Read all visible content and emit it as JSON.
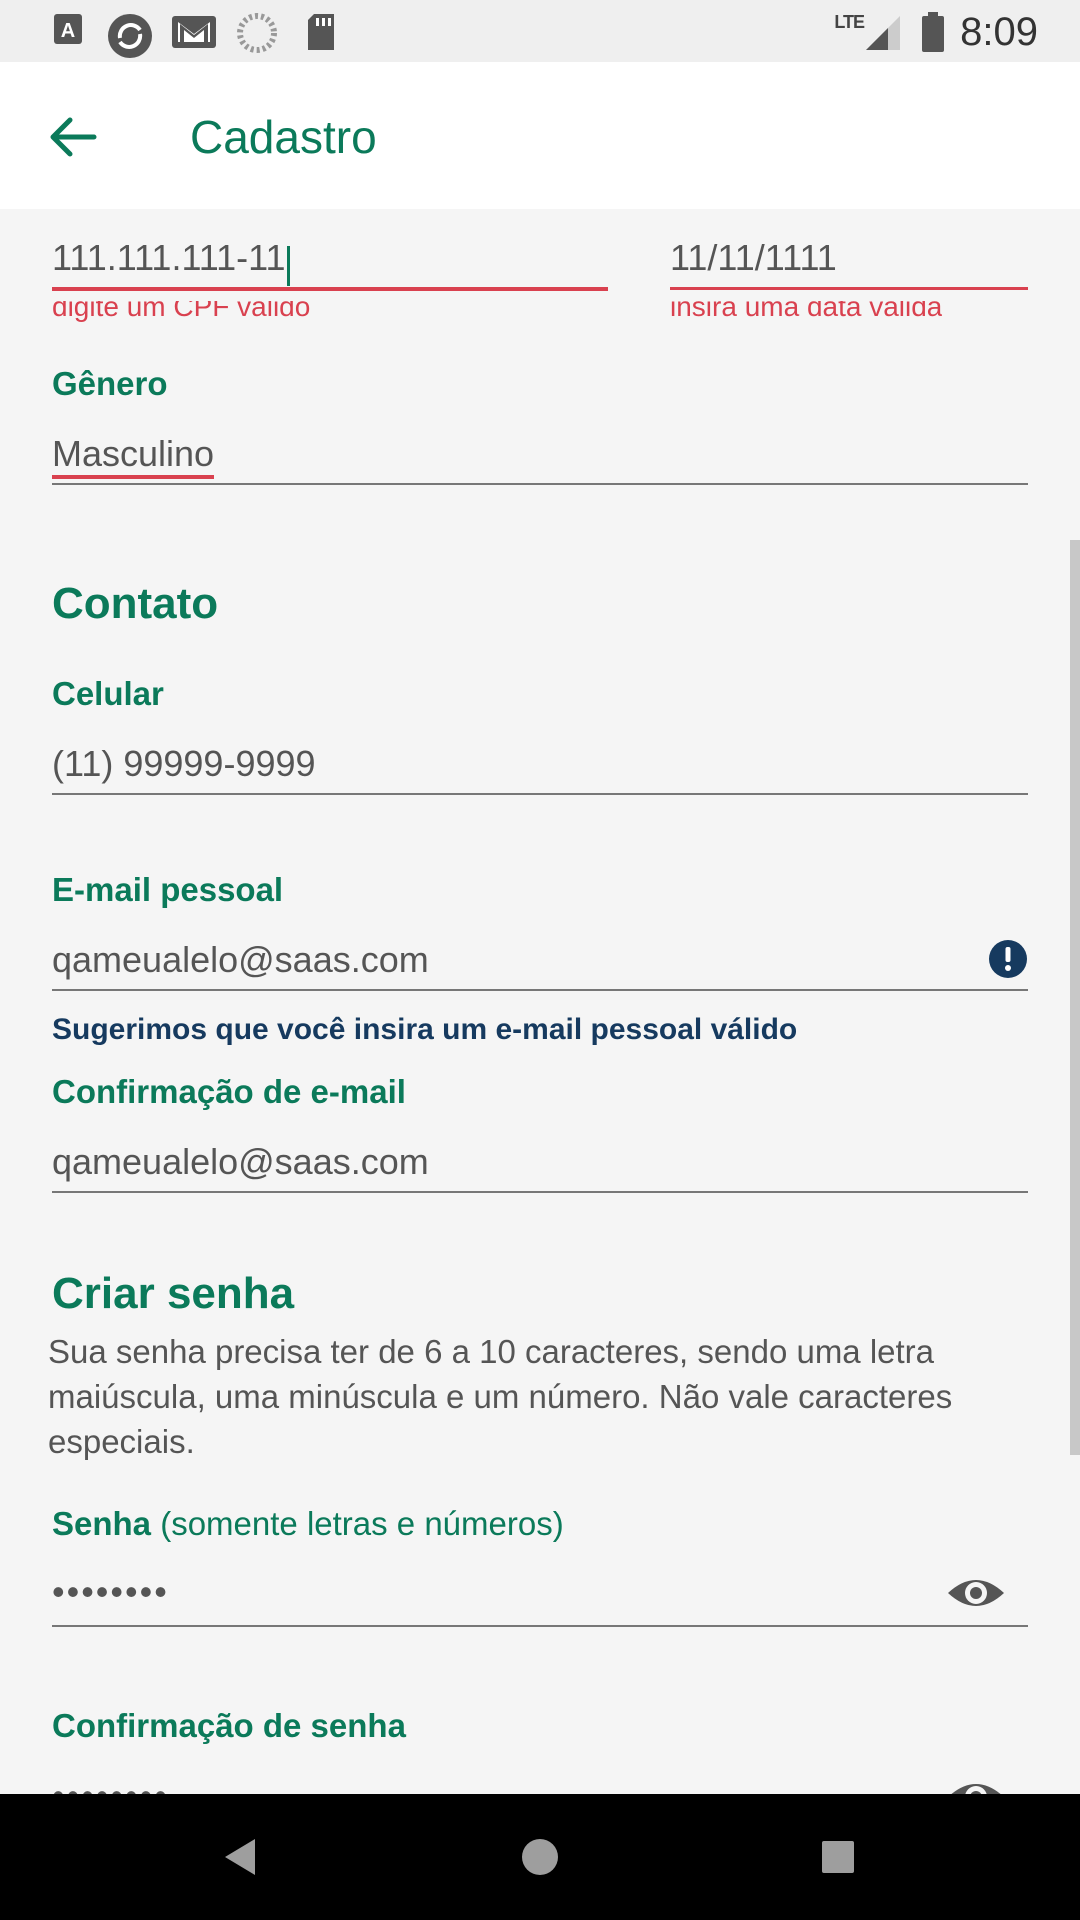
{
  "status_bar": {
    "time": "8:09",
    "network": "LTE",
    "icons": [
      "text-a-icon",
      "sync-icon",
      "gmail-icon",
      "loading-icon",
      "sd-card-icon",
      "signal-icon",
      "battery-icon"
    ]
  },
  "app_bar": {
    "title": "Cadastro",
    "back_icon": "arrow-left-icon"
  },
  "form": {
    "cpf": {
      "value": "111.111.111-11",
      "error": "digite um CPF válido"
    },
    "birthdate": {
      "value": "11/11/1111",
      "error": "insira uma data válida"
    },
    "gender": {
      "label": "Gênero",
      "value": "Masculino"
    },
    "contact": {
      "title": "Contato",
      "phone": {
        "label": "Celular",
        "placeholder": "(11) 99999-9999"
      },
      "email": {
        "label": "E-mail pessoal",
        "value": "qameualelo@saas.com",
        "hint": "Sugerimos que você insira um e-mail pessoal válido"
      },
      "email_confirm": {
        "label": "Confirmação de e-mail",
        "value": "qameualelo@saas.com"
      }
    },
    "password": {
      "title": "Criar senha",
      "description": "Sua senha precisa ter de 6 a 10 caracteres, sendo uma letra maiúscula, uma minúscula e um número. Não vale caracteres especiais.",
      "label": "Senha",
      "label_note": "(somente letras e números)",
      "value": "••••••••",
      "confirm_label": "Confirmação de senha",
      "confirm_value": "••••••••"
    }
  },
  "colors": {
    "brand_green": "#0b7a5a",
    "error_red": "#d9414f",
    "hint_navy": "#163a5f"
  }
}
